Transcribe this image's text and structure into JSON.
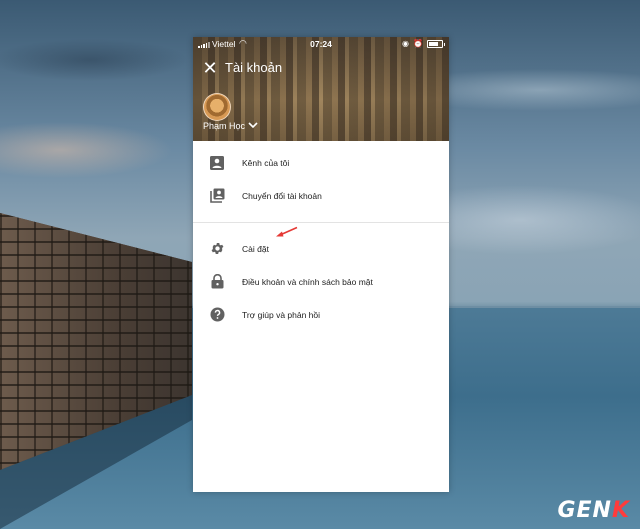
{
  "status_bar": {
    "carrier": "Viettel",
    "time": "07:24"
  },
  "header": {
    "title": "Tài khoản",
    "user_name": "Phạm Học"
  },
  "menu": {
    "items": [
      {
        "label": "Kênh của tôi",
        "icon": "person-box-icon"
      },
      {
        "label": "Chuyển đổi tài khoản",
        "icon": "switch-account-icon"
      },
      {
        "label": "Cài đặt",
        "icon": "gear-icon"
      },
      {
        "label": "Điều khoản và chính sách bảo mật",
        "icon": "lock-icon"
      },
      {
        "label": "Trợ giúp và phản hồi",
        "icon": "help-circle-icon"
      }
    ]
  },
  "watermark": {
    "logo": "GENK"
  },
  "colors": {
    "icon": "#616161",
    "annotation_arrow": "#e53935",
    "divider": "#e3e3e3"
  }
}
